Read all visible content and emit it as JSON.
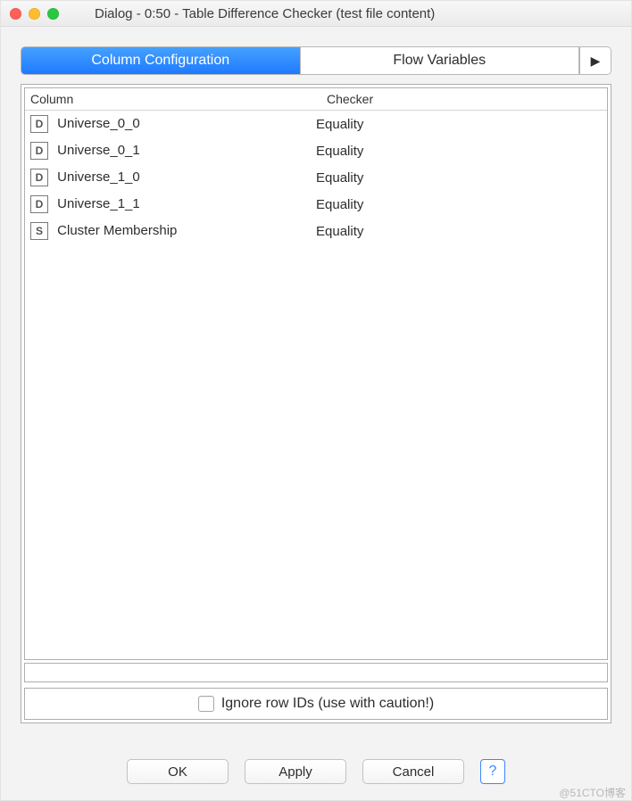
{
  "window": {
    "title": "Dialog - 0:50 - Table Difference Checker (test file content)"
  },
  "tabs": {
    "active": "Column Configuration",
    "items": [
      "Column Configuration",
      "Flow Variables"
    ],
    "overflow_glyph": "▶"
  },
  "table": {
    "headers": {
      "col1": "Column",
      "col2": "Checker"
    },
    "rows": [
      {
        "type": "D",
        "name": "Universe_0_0",
        "checker": "Equality"
      },
      {
        "type": "D",
        "name": "Universe_0_1",
        "checker": "Equality"
      },
      {
        "type": "D",
        "name": "Universe_1_0",
        "checker": "Equality"
      },
      {
        "type": "D",
        "name": "Universe_1_1",
        "checker": "Equality"
      },
      {
        "type": "S",
        "name": "Cluster Membership",
        "checker": "Equality"
      }
    ]
  },
  "checkbox": {
    "label": "Ignore row IDs (use with caution!)",
    "checked": false
  },
  "buttons": {
    "ok": "OK",
    "apply": "Apply",
    "cancel": "Cancel",
    "help_glyph": "?"
  },
  "watermark": "@51CTO博客"
}
